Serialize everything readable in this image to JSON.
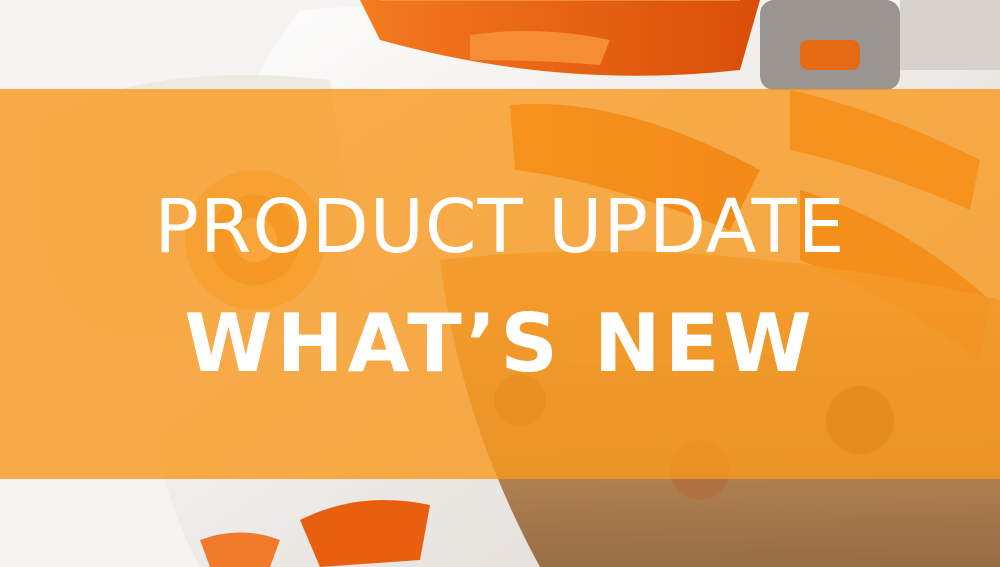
{
  "banner": {
    "title": "PRODUCT UPDATE",
    "subtitle": "WHAT’S NEW",
    "overlay_color": "#F7981D"
  },
  "background": {
    "accent_color": "#F26A12",
    "base_color": "#F4F2F0"
  }
}
